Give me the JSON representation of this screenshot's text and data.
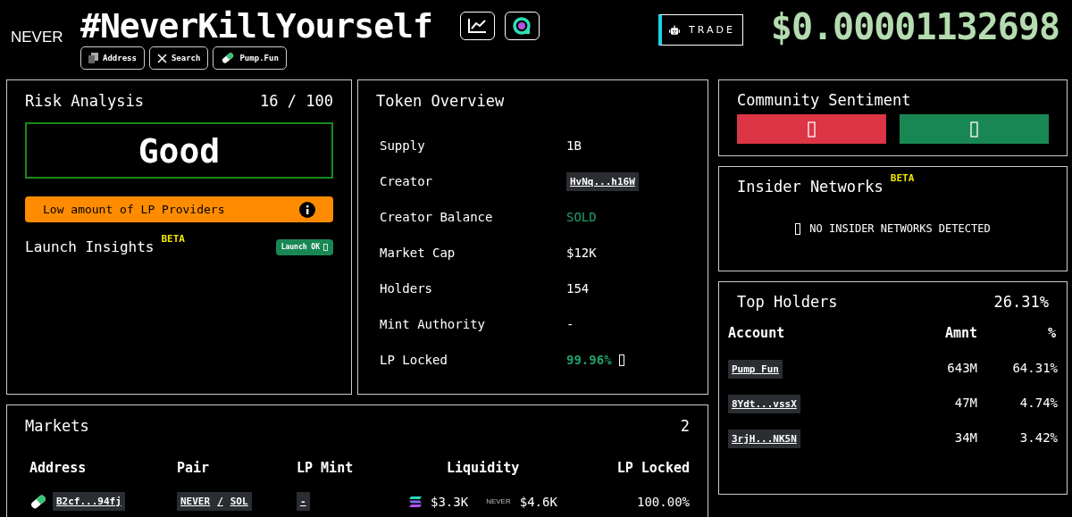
{
  "header": {
    "symbol": "NEVER",
    "title": "#NeverKillYourself",
    "links": [
      {
        "kind": "copy",
        "label": "Address"
      },
      {
        "kind": "x",
        "label": "Search"
      },
      {
        "kind": "pill",
        "label": "Pump.Fun"
      }
    ],
    "icon_buttons": [
      {
        "kind": "chart"
      },
      {
        "kind": "ring"
      }
    ],
    "trade": "TRADE",
    "price": "$0.00001132698"
  },
  "risk": {
    "title": "Risk Analysis",
    "score": "16 / 100",
    "rating": "Good",
    "warnings": [
      "Low amount of LP Providers"
    ],
    "insights_title": "Launch Insights",
    "beta": "BETA",
    "insights_badge": "Launch OK"
  },
  "token": {
    "title": "Token Overview",
    "rows": [
      {
        "kind": "text",
        "label": "Supply",
        "value": "1B"
      },
      {
        "kind": "address",
        "label": "Creator",
        "value": "HvNq...h16W"
      },
      {
        "kind": "good",
        "label": "Creator Balance",
        "value": "SOLD"
      },
      {
        "kind": "text",
        "label": "Market Cap",
        "value": "$12K"
      },
      {
        "kind": "text",
        "label": "Holders",
        "value": "154"
      },
      {
        "kind": "text",
        "label": "Mint Authority",
        "value": "-"
      },
      {
        "kind": "locked",
        "label": "LP Locked",
        "value": "99.96%"
      }
    ]
  },
  "sentiment": {
    "title": "Community Sentiment",
    "buttons": [
      {
        "color": "#dc3545"
      },
      {
        "color": "#198754"
      }
    ]
  },
  "insider": {
    "title": "Insider Networks",
    "beta": "BETA",
    "message": "NO INSIDER NETWORKS DETECTED"
  },
  "holders": {
    "title": "Top Holders",
    "total": "26.31%",
    "columns": [
      "Account",
      "Amnt",
      "%"
    ],
    "rows": [
      {
        "account": "Pump Fun",
        "amount": "643M",
        "percent": "64.31%"
      },
      {
        "account": "8Ydt...vssX",
        "amount": "47M",
        "percent": "4.74%"
      },
      {
        "account": "3rjH...NK5N",
        "amount": "34M",
        "percent": "3.42%"
      }
    ]
  },
  "markets": {
    "title": "Markets",
    "count": "2",
    "columns": [
      "Address",
      "Pair",
      "LP Mint",
      "Liquidity",
      "LP Locked"
    ],
    "rows": [
      {
        "address": "B2cf...94fj",
        "base": "NEVER",
        "separator": "/",
        "quote": "SOL",
        "lp_mint": "-",
        "liquidity_quote": "$3.3K",
        "token_mark": "NEVER",
        "liquidity_base": "$4.6K",
        "lp_locked": "100.00%"
      }
    ]
  }
}
